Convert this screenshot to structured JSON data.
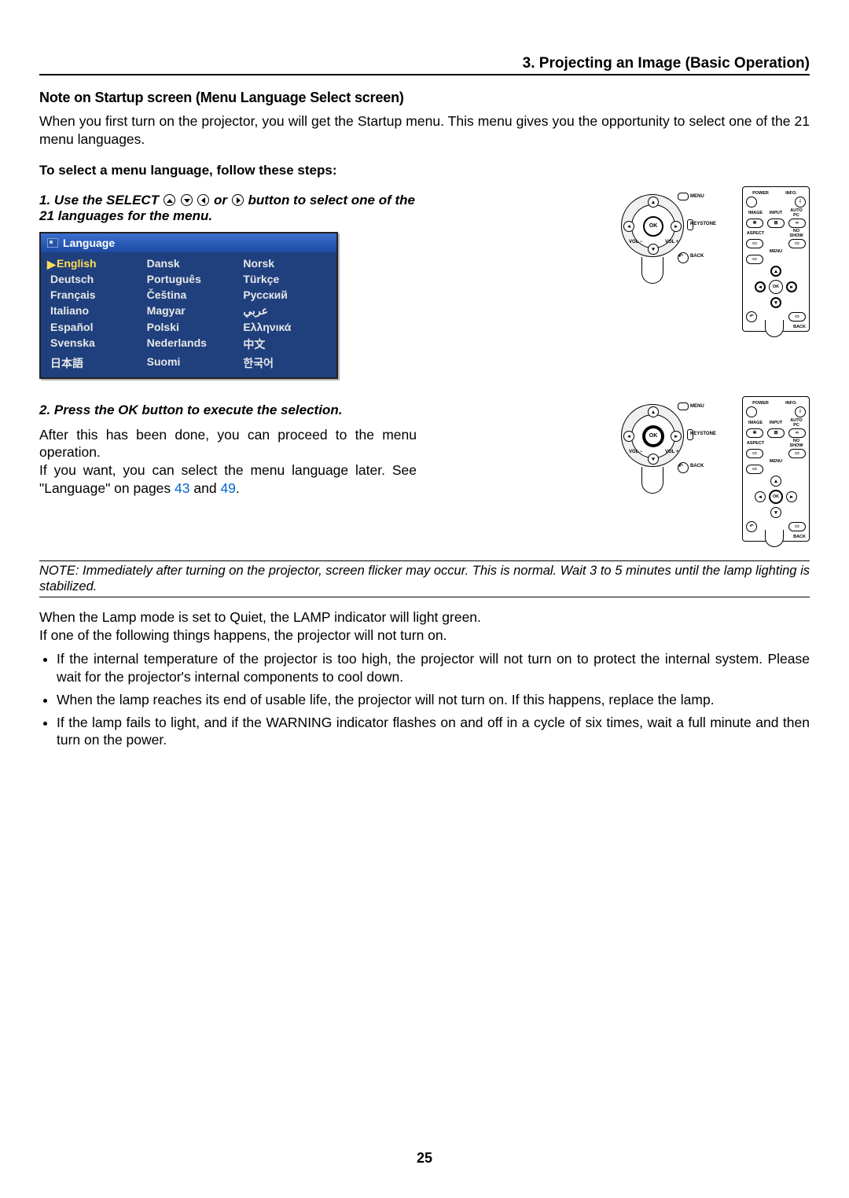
{
  "header": {
    "section": "3. Projecting an Image (Basic Operation)"
  },
  "title": "Note on Startup screen (Menu Language Select screen)",
  "intro": "When you first turn on the projector, you will get the Startup menu. This menu gives you the opportunity to select one of the 21 menu languages.",
  "steps_intro": "To select a menu language, follow these steps:",
  "step1_a": "1.  Use the SELECT ",
  "step1_mid": " or ",
  "step1_b": " button to select one of the 21 languages for the menu.",
  "step2": "2.  Press the OK button to execute the selection.",
  "after_a": "After this has been done, you can proceed to the menu operation.",
  "after_b_1": "If you want, you can select the menu language later. See \"Language\" on pages ",
  "after_b_link1": "43",
  "after_b_mid": " and ",
  "after_b_link2": "49",
  "after_b_end": ".",
  "osd": {
    "title": "Language",
    "cells": [
      [
        "English",
        "Dansk",
        "Norsk"
      ],
      [
        "Deutsch",
        "Português",
        "Türkçe"
      ],
      [
        "Français",
        "Čeština",
        "Русский"
      ],
      [
        "Italiano",
        "Magyar",
        "عربي"
      ],
      [
        "Español",
        "Polski",
        "Ελληνικά"
      ],
      [
        "Svenska",
        "Nederlands",
        "中文"
      ],
      [
        "日本語",
        "Suomi",
        "한국어"
      ]
    ]
  },
  "ctrl": {
    "ok": "OK",
    "menu": "MENU",
    "keystone": "KEYSTONE",
    "back": "BACK",
    "vol_minus": "VOL\n−",
    "vol_plus": "VOL\n+"
  },
  "remote": {
    "power": "POWER",
    "info": "INFO.",
    "image": "IMAGE",
    "input": "INPUT",
    "autopc": "AUTO PC",
    "aspect": "ASPECT",
    "noshow": "NO SHOW",
    "menu": "MENU",
    "ok": "OK",
    "back": "BACK"
  },
  "note": "NOTE: Immediately after turning on the projector, screen flicker may occur. This is normal. Wait 3 to 5 minutes until the lamp lighting is stabilized.",
  "lamp_quiet": "When the Lamp mode is set to Quiet, the LAMP indicator will light green.",
  "following": "If one of the following things happens, the projector will not turn on.",
  "bullets": [
    "If the internal temperature of the projector is too high, the projector will not turn on to protect the internal system. Please wait for the projector's internal components to cool down.",
    "When the lamp reaches its end of usable life, the projector will not turn on. If this happens, replace the lamp.",
    "If the lamp fails to light, and if the WARNING indicator flashes on and off in a cycle of six times, wait a full minute and then turn on the power."
  ],
  "pagenum": "25"
}
